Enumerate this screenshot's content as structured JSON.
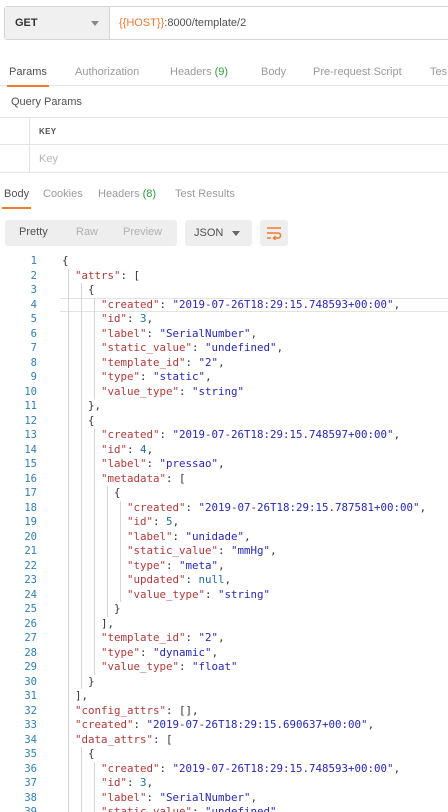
{
  "request": {
    "method": "GET",
    "url_var": "{{HOST}}",
    "url_rest": ":8000/template/2"
  },
  "request_tabs": [
    {
      "label": "Params",
      "active": true
    },
    {
      "label": "Authorization"
    },
    {
      "label": "Headers",
      "count": "(9)"
    },
    {
      "label": "Body"
    },
    {
      "label": "Pre-request Script"
    },
    {
      "label": "Tes"
    }
  ],
  "query_params": {
    "title": "Query Params",
    "key_header": "KEY",
    "key_placeholder": "Key"
  },
  "response_tabs": [
    {
      "label": "Body",
      "active": true
    },
    {
      "label": "Cookies"
    },
    {
      "label": "Headers",
      "count": "(8)"
    },
    {
      "label": "Test Results"
    }
  ],
  "view": {
    "modes": [
      "Pretty",
      "Raw",
      "Preview"
    ],
    "selected": "Pretty",
    "format": "JSON",
    "wrap_icon": "wrap-lines-icon"
  },
  "colors": {
    "accent": "#ef7a30",
    "count_green": "#2e9e3a",
    "key": "#b13a3a",
    "string": "#2727b3",
    "number": "#1f6e9e",
    "line_number": "#2f7fb3"
  },
  "code": {
    "highlight_line": 4,
    "lines": [
      {
        "n": "1",
        "i": 0,
        "text": "{"
      },
      {
        "n": "2",
        "i": 1,
        "text": "\"attrs\": ["
      },
      {
        "n": "3",
        "i": 2,
        "text": "{"
      },
      {
        "n": "4",
        "i": 3,
        "text": "\"created\": \"2019-07-26T18:29:15.748593+00:00\","
      },
      {
        "n": "5",
        "i": 3,
        "text": "\"id\": 3,"
      },
      {
        "n": "6",
        "i": 3,
        "text": "\"label\": \"SerialNumber\","
      },
      {
        "n": "7",
        "i": 3,
        "text": "\"static_value\": \"undefined\","
      },
      {
        "n": "8",
        "i": 3,
        "text": "\"template_id\": \"2\","
      },
      {
        "n": "9",
        "i": 3,
        "text": "\"type\": \"static\","
      },
      {
        "n": "10",
        "i": 3,
        "text": "\"value_type\": \"string\""
      },
      {
        "n": "11",
        "i": 2,
        "text": "},"
      },
      {
        "n": "12",
        "i": 2,
        "text": "{"
      },
      {
        "n": "13",
        "i": 3,
        "text": "\"created\": \"2019-07-26T18:29:15.748597+00:00\","
      },
      {
        "n": "14",
        "i": 3,
        "text": "\"id\": 4,"
      },
      {
        "n": "15",
        "i": 3,
        "text": "\"label\": \"pressao\","
      },
      {
        "n": "16",
        "i": 3,
        "text": "\"metadata\": ["
      },
      {
        "n": "17",
        "i": 4,
        "text": "{"
      },
      {
        "n": "18",
        "i": 5,
        "text": "\"created\": \"2019-07-26T18:29:15.787581+00:00\","
      },
      {
        "n": "19",
        "i": 5,
        "text": "\"id\": 5,"
      },
      {
        "n": "20",
        "i": 5,
        "text": "\"label\": \"unidade\","
      },
      {
        "n": "21",
        "i": 5,
        "text": "\"static_value\": \"mmHg\","
      },
      {
        "n": "22",
        "i": 5,
        "text": "\"type\": \"meta\","
      },
      {
        "n": "23",
        "i": 5,
        "text": "\"updated\": null,"
      },
      {
        "n": "24",
        "i": 5,
        "text": "\"value_type\": \"string\""
      },
      {
        "n": "25",
        "i": 4,
        "text": "}"
      },
      {
        "n": "26",
        "i": 3,
        "text": "],"
      },
      {
        "n": "27",
        "i": 3,
        "text": "\"template_id\": \"2\","
      },
      {
        "n": "28",
        "i": 3,
        "text": "\"type\": \"dynamic\","
      },
      {
        "n": "29",
        "i": 3,
        "text": "\"value_type\": \"float\""
      },
      {
        "n": "30",
        "i": 2,
        "text": "}"
      },
      {
        "n": "31",
        "i": 1,
        "text": "],"
      },
      {
        "n": "32",
        "i": 1,
        "text": "\"config_attrs\": [],"
      },
      {
        "n": "33",
        "i": 1,
        "text": "\"created\": \"2019-07-26T18:29:15.690637+00:00\","
      },
      {
        "n": "34",
        "i": 1,
        "text": "\"data_attrs\": ["
      },
      {
        "n": "35",
        "i": 2,
        "text": "{"
      },
      {
        "n": "36",
        "i": 3,
        "text": "\"created\": \"2019-07-26T18:29:15.748593+00:00\","
      },
      {
        "n": "37",
        "i": 3,
        "text": "\"id\": 3,"
      },
      {
        "n": "38",
        "i": 3,
        "text": "\"label\": \"SerialNumber\","
      },
      {
        "n": "39",
        "i": 3,
        "text": "\"static_value\": \"undefined\","
      }
    ]
  }
}
